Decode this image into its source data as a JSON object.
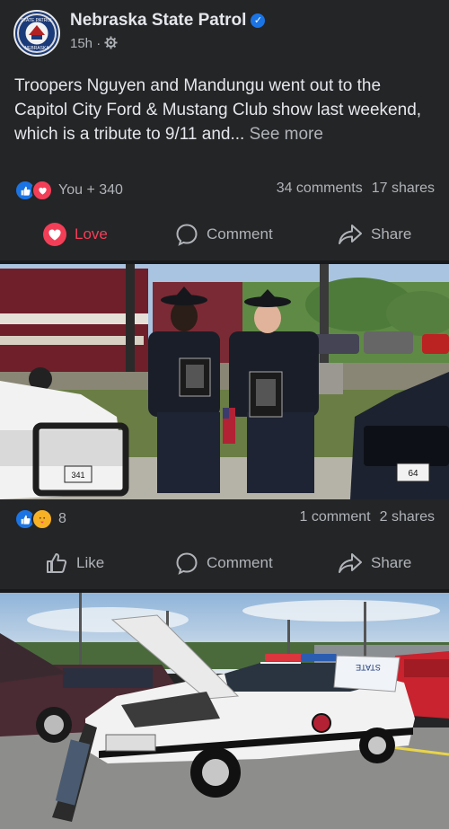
{
  "post": {
    "page_name": "Nebraska State Patrol",
    "time": "15h",
    "separator": "·",
    "text": "Troopers Nguyen and Mandungu went out to the Capitol City Ford & Mustang Club show last weekend, which is a tribute to 9/11 and...",
    "see_more": "See more",
    "reactions_text": "You + 340",
    "comments": "34 comments",
    "shares": "17 shares",
    "actions": {
      "love": "Love",
      "comment": "Comment",
      "share": "Share"
    }
  },
  "photo_one": {
    "reaction_count": "8",
    "comments": "1 comment",
    "shares": "2 shares",
    "actions": {
      "like": "Like",
      "comment": "Comment",
      "share": "Share"
    },
    "plaque_numbers": [
      "341",
      "64"
    ]
  },
  "photo_two": {
    "door_text": "STATE"
  },
  "colors": {
    "background": "#242526",
    "accent_blue": "#1b74e4",
    "love_red": "#f33e58"
  }
}
